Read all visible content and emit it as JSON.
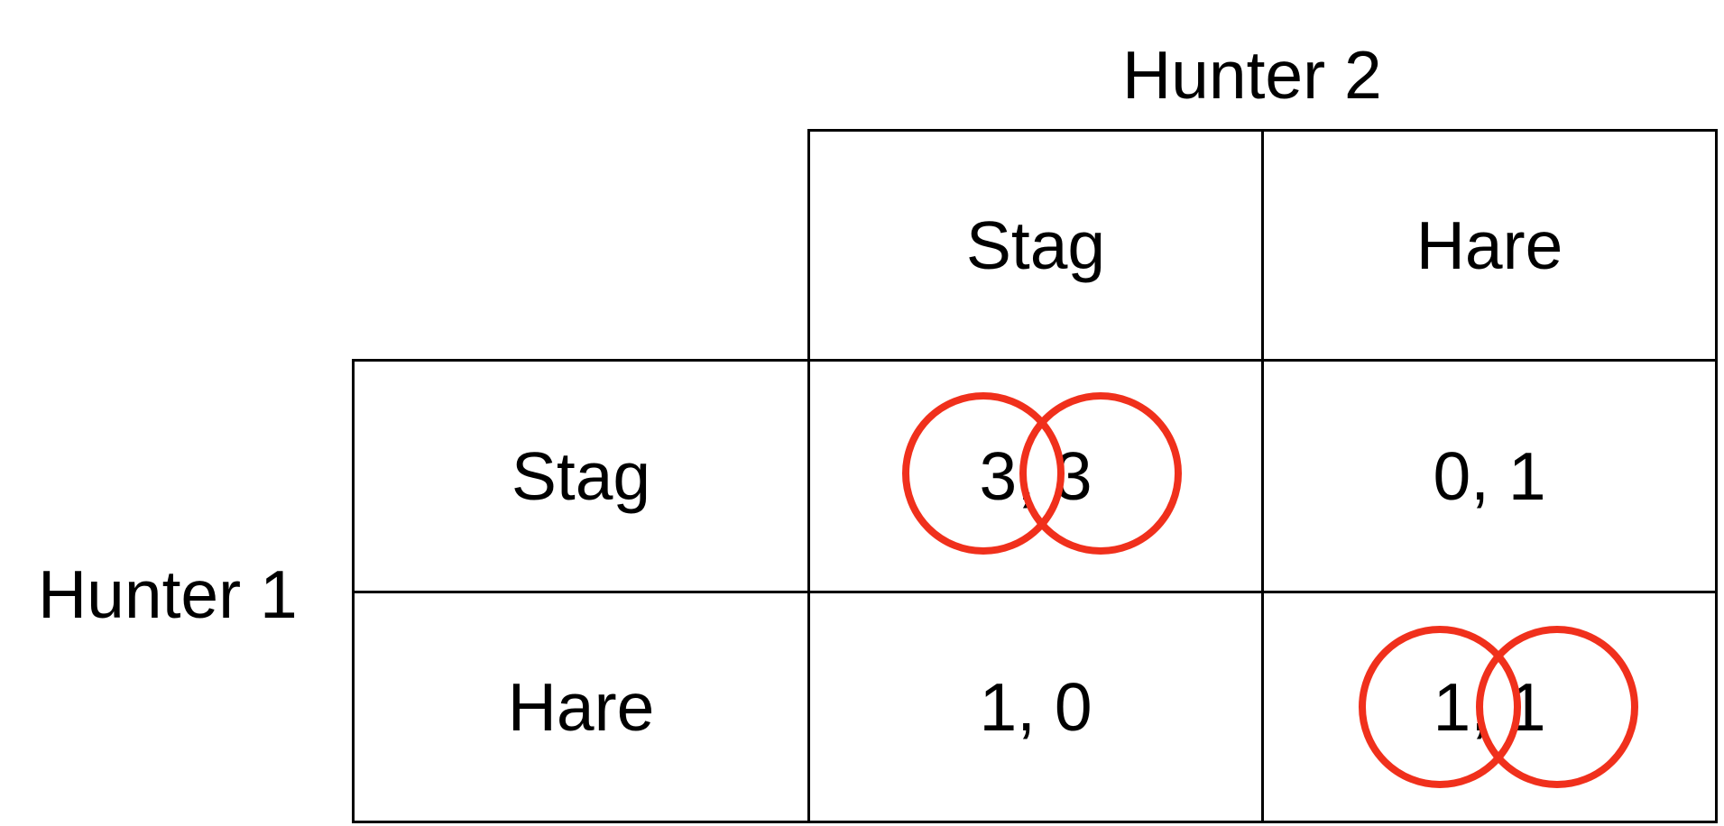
{
  "players": {
    "column_player": "Hunter 2",
    "row_player": "Hunter 1"
  },
  "strategies": {
    "columns": [
      "Stag",
      "Hare"
    ],
    "rows": [
      "Stag",
      "Hare"
    ]
  },
  "payoffs": [
    [
      "3, 3",
      "0, 1"
    ],
    [
      "1, 0",
      "1, 1"
    ]
  ],
  "equilibrium_cells": [
    "Stag-Stag",
    "Hare-Hare"
  ],
  "colors": {
    "grid": "#000000",
    "text": "#000000",
    "best_response_circle": "#f0301c"
  }
}
